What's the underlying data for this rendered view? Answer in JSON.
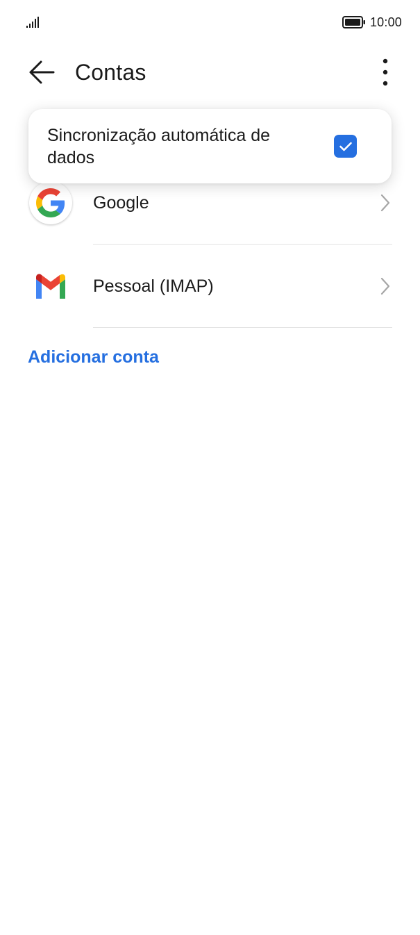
{
  "status_bar": {
    "signal_icon": "signal-bars-icon",
    "battery_icon": "battery-icon",
    "time": "10:00"
  },
  "app_bar": {
    "back_icon": "arrow-back-icon",
    "title": "Contas",
    "more_icon": "more-vertical-icon"
  },
  "popup_menu": {
    "auto_sync_label": "Sincronização automática de dados",
    "auto_sync_checked": true,
    "checkbox_icon": "checkmark-icon"
  },
  "accounts": [
    {
      "label": "Google",
      "icon": "google-logo-icon",
      "chevron_icon": "chevron-right-icon"
    },
    {
      "label": "Pessoal (IMAP)",
      "icon": "gmail-logo-icon",
      "chevron_icon": "chevron-right-icon"
    }
  ],
  "add_account_label": "Adicionar conta",
  "colors": {
    "accent": "#256fe0",
    "text_primary": "#1a1a1a",
    "divider": "#e3e3e3",
    "chevron": "#a6a6a6",
    "background": "#ffffff"
  }
}
